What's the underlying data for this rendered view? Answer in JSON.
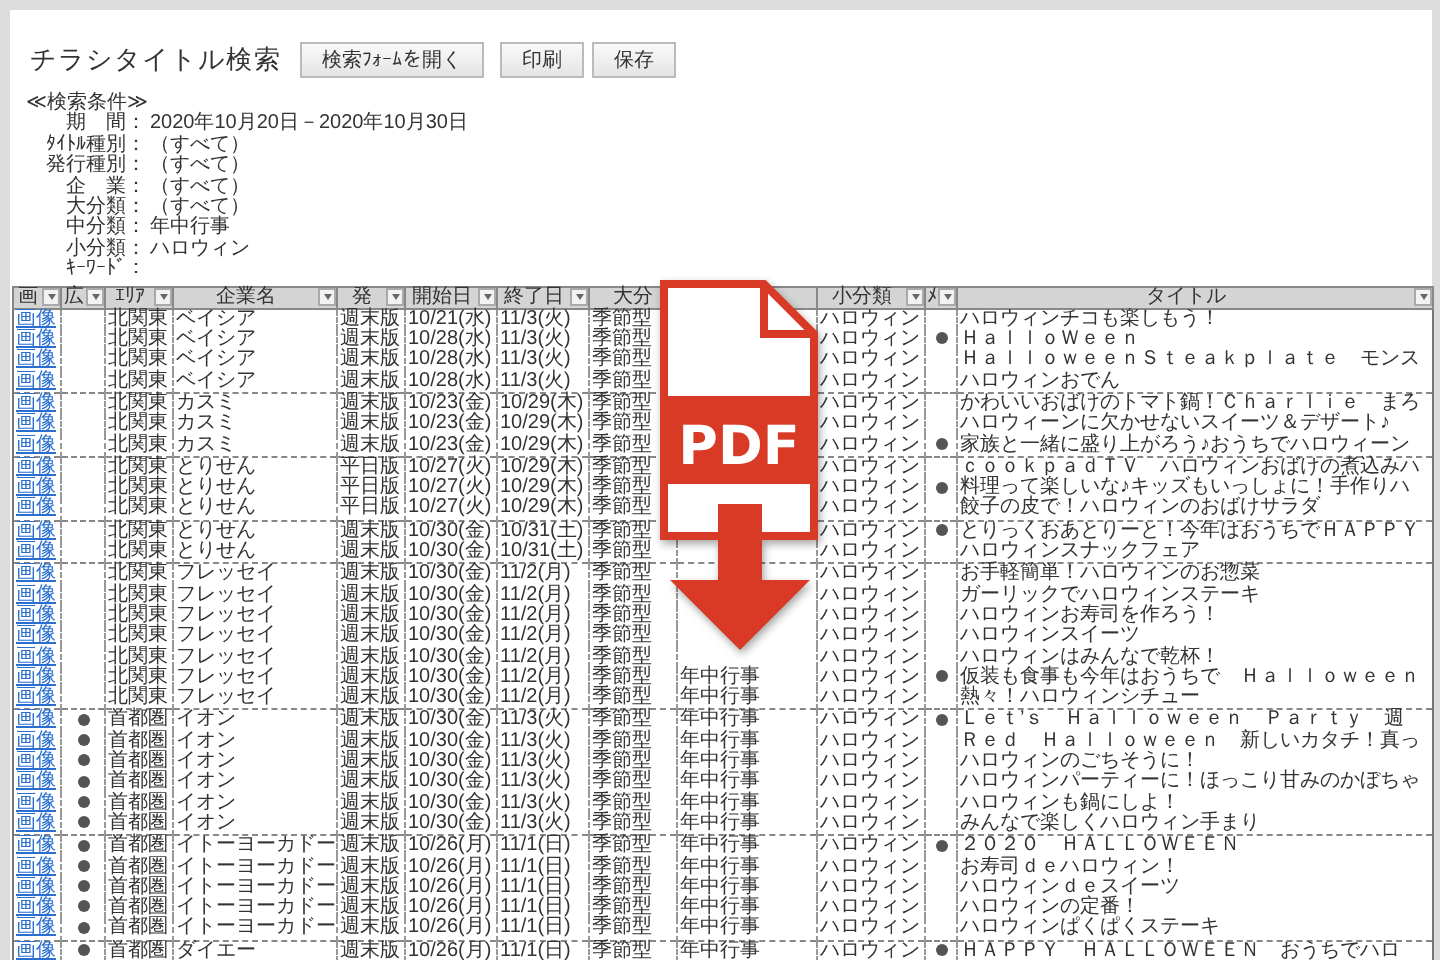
{
  "page_title": "チラシタイトル検索",
  "buttons": [
    "検索ﾌｫｰﾑを開く",
    "印刷",
    "保存"
  ],
  "conditions_heading": "≪検索条件≫",
  "conditions": [
    {
      "label": "期　間：",
      "value": "2020年10月20日－2020年10月30日"
    },
    {
      "label": "ﾀｲﾄﾙ種別：",
      "value": "（すべて）"
    },
    {
      "label": "発行種別：",
      "value": "（すべて）"
    },
    {
      "label": "企　業：",
      "value": "（すべて）"
    },
    {
      "label": "大分類：",
      "value": "（すべて）"
    },
    {
      "label": "中分類：",
      "value": "年中行事"
    },
    {
      "label": "小分類：",
      "value": "ハロウィン"
    },
    {
      "label": "ｷｰﾜｰﾄﾞ："
    }
  ],
  "overlay_badge": {
    "label": "PDF"
  },
  "table": {
    "columns": [
      {
        "label": "画",
        "filter": true
      },
      {
        "label": "広",
        "filter": true
      },
      {
        "label": "ｴﾘｱ",
        "filter": true
      },
      {
        "label": "企業名",
        "filter": true
      },
      {
        "label": "発",
        "filter": true
      },
      {
        "label": "開始日",
        "filter": true
      },
      {
        "label": "終了日",
        "filter": true
      },
      {
        "label": "大分",
        "filter": false
      },
      {
        "filter": false
      },
      {
        "label": "小分類",
        "filter": true
      },
      {
        "label": "ﾒ",
        "filter": true
      },
      {
        "label": "タイトル",
        "filter": true
      }
    ],
    "rows": [
      {
        "link": "画像",
        "ad": false,
        "area": "北関東",
        "company": "ベイシア",
        "edition": "週末版",
        "start": "10/21(水)",
        "end": "11/3(火)",
        "major": "季節型",
        "minor": "ハロウィン",
        "main": false,
        "title": "ハロウィンチコも楽しもう！",
        "group_start": true
      },
      {
        "link": "画像",
        "ad": false,
        "area": "北関東",
        "company": "ベイシア",
        "edition": "週末版",
        "start": "10/28(水)",
        "end": "11/3(火)",
        "major": "季節型",
        "minor": "ハロウィン",
        "main": true,
        "title": "ＨａｌｌｏＷｅｅｎ",
        "group_start": false
      },
      {
        "link": "画像",
        "ad": false,
        "area": "北関東",
        "company": "ベイシア",
        "edition": "週末版",
        "start": "10/28(水)",
        "end": "11/3(火)",
        "major": "季節型",
        "minor": "ハロウィン",
        "main": false,
        "title": "ＨａｌｌｏｗｅｅｎＳｔｅａｋｐｌａｔｅ　モンス",
        "group_start": false
      },
      {
        "link": "画像",
        "ad": false,
        "area": "北関東",
        "company": "ベイシア",
        "edition": "週末版",
        "start": "10/28(水)",
        "end": "11/3(火)",
        "major": "季節型",
        "minor": "ハロウィン",
        "main": false,
        "title": "ハロウィンおでん",
        "group_start": false
      },
      {
        "link": "画像",
        "ad": false,
        "area": "北関東",
        "company": "カスミ",
        "edition": "週末版",
        "start": "10/23(金)",
        "end": "10/29(木)",
        "major": "季節型",
        "minor": "ハロウィン",
        "main": false,
        "title": "かわいいおばけのトマト鍋！Ｃｈａｒｌｉｅ　まろ",
        "group_start": true
      },
      {
        "link": "画像",
        "ad": false,
        "area": "北関東",
        "company": "カスミ",
        "edition": "週末版",
        "start": "10/23(金)",
        "end": "10/29(木)",
        "major": "季節型",
        "minor": "ハロウィン",
        "main": false,
        "title": "ハロウィーンに欠かせないスイーツ＆デザート♪",
        "group_start": false
      },
      {
        "link": "画像",
        "ad": false,
        "area": "北関東",
        "company": "カスミ",
        "edition": "週末版",
        "start": "10/23(金)",
        "end": "10/29(木)",
        "major": "季節型",
        "minor": "ハロウィン",
        "main": true,
        "title": "家族と一緒に盛り上がろう♪おうちでハロウィーン",
        "group_start": false
      },
      {
        "link": "画像",
        "ad": false,
        "area": "北関東",
        "company": "とりせん",
        "edition": "平日版",
        "start": "10/27(火)",
        "end": "10/29(木)",
        "major": "季節型",
        "minor": "ハロウィン",
        "main": false,
        "title": "ｃｏｏｋｐａｄＴＶ　ハロウィンおばけの煮込みハ",
        "group_start": true
      },
      {
        "link": "画像",
        "ad": false,
        "area": "北関東",
        "company": "とりせん",
        "edition": "平日版",
        "start": "10/27(火)",
        "end": "10/29(木)",
        "major": "季節型",
        "minor": "ハロウィン",
        "main": true,
        "title": "料理って楽しいな♪キッズもいっしょに！手作りハ",
        "group_start": false
      },
      {
        "link": "画像",
        "ad": false,
        "area": "北関東",
        "company": "とりせん",
        "edition": "平日版",
        "start": "10/27(火)",
        "end": "10/29(木)",
        "major": "季節型",
        "minor": "ハロウィン",
        "main": false,
        "title": "餃子の皮で！ハロウィンのおばけサラダ",
        "group_start": false
      },
      {
        "link": "画像",
        "ad": false,
        "area": "北関東",
        "company": "とりせん",
        "edition": "週末版",
        "start": "10/30(金)",
        "end": "10/31(土)",
        "major": "季節型",
        "minor": "ハロウィン",
        "main": true,
        "title": "とりっくおあとりーと！今年はおうちでＨＡＰＰＹ",
        "group_start": true
      },
      {
        "link": "画像",
        "ad": false,
        "area": "北関東",
        "company": "とりせん",
        "edition": "週末版",
        "start": "10/30(金)",
        "end": "10/31(土)",
        "major": "季節型",
        "minor": "ハロウィン",
        "main": false,
        "title": "ハロウィンスナックフェア",
        "group_start": false
      },
      {
        "link": "画像",
        "ad": false,
        "area": "北関東",
        "company": "フレッセイ",
        "edition": "週末版",
        "start": "10/30(金)",
        "end": "11/2(月)",
        "major": "季節型",
        "minor": "ハロウィン",
        "main": false,
        "title": "お手軽簡単！ハロウィンのお惣菜",
        "group_start": true
      },
      {
        "link": "画像",
        "ad": false,
        "area": "北関東",
        "company": "フレッセイ",
        "edition": "週末版",
        "start": "10/30(金)",
        "end": "11/2(月)",
        "major": "季節型",
        "minor": "ハロウィン",
        "main": false,
        "title": "ガーリックでハロウィンステーキ",
        "group_start": false
      },
      {
        "link": "画像",
        "ad": false,
        "area": "北関東",
        "company": "フレッセイ",
        "edition": "週末版",
        "start": "10/30(金)",
        "end": "11/2(月)",
        "major": "季節型",
        "minor": "ハロウィン",
        "main": false,
        "title": "ハロウィンお寿司を作ろう！",
        "group_start": false
      },
      {
        "link": "画像",
        "ad": false,
        "area": "北関東",
        "company": "フレッセイ",
        "edition": "週末版",
        "start": "10/30(金)",
        "end": "11/2(月)",
        "major": "季節型",
        "minor": "ハロウィン",
        "main": false,
        "title": "ハロウィンスイーツ",
        "group_start": false
      },
      {
        "link": "画像",
        "ad": false,
        "area": "北関東",
        "company": "フレッセイ",
        "edition": "週末版",
        "start": "10/30(金)",
        "end": "11/2(月)",
        "major": "季節型",
        "minor": "ハロウィン",
        "main": false,
        "title": "ハロウィンはみんなで乾杯！",
        "group_start": false
      },
      {
        "link": "画像",
        "ad": false,
        "area": "北関東",
        "company": "フレッセイ",
        "edition": "週末版",
        "start": "10/30(金)",
        "end": "11/2(月)",
        "major": "季節型",
        "mid": "年中行事",
        "minor": "ハロウィン",
        "main": true,
        "title": "仮装も食事も今年はおうちで　Ｈａｌｌｏｗｅｅｎ",
        "group_start": false
      },
      {
        "link": "画像",
        "ad": false,
        "area": "北関東",
        "company": "フレッセイ",
        "edition": "週末版",
        "start": "10/30(金)",
        "end": "11/2(月)",
        "major": "季節型",
        "mid": "年中行事",
        "minor": "ハロウィン",
        "main": false,
        "title": "熱々！ハロウィンシチュー",
        "group_start": false
      },
      {
        "link": "画像",
        "ad": true,
        "area": "首都圏",
        "company": "イオン",
        "edition": "週末版",
        "start": "10/30(金)",
        "end": "11/3(火)",
        "major": "季節型",
        "mid": "年中行事",
        "minor": "ハロウィン",
        "main": true,
        "title": "Ｌｅｔ’ｓ　Ｈａｌｌｏｗｅｅｎ　Ｐａｒｔｙ　週",
        "group_start": true
      },
      {
        "link": "画像",
        "ad": true,
        "area": "首都圏",
        "company": "イオン",
        "edition": "週末版",
        "start": "10/30(金)",
        "end": "11/3(火)",
        "major": "季節型",
        "mid": "年中行事",
        "minor": "ハロウィン",
        "main": false,
        "title": "Ｒｅｄ　Ｈａｌｌｏｗｅｅｎ　新しいカタチ！真っ",
        "group_start": false
      },
      {
        "link": "画像",
        "ad": true,
        "area": "首都圏",
        "company": "イオン",
        "edition": "週末版",
        "start": "10/30(金)",
        "end": "11/3(火)",
        "major": "季節型",
        "mid": "年中行事",
        "minor": "ハロウィン",
        "main": false,
        "title": "ハロウィンのごちそうに！",
        "group_start": false
      },
      {
        "link": "画像",
        "ad": true,
        "area": "首都圏",
        "company": "イオン",
        "edition": "週末版",
        "start": "10/30(金)",
        "end": "11/3(火)",
        "major": "季節型",
        "mid": "年中行事",
        "minor": "ハロウィン",
        "main": false,
        "title": "ハロウィンパーティーに！ほっこり甘みのかぼちゃ",
        "group_start": false
      },
      {
        "link": "画像",
        "ad": true,
        "area": "首都圏",
        "company": "イオン",
        "edition": "週末版",
        "start": "10/30(金)",
        "end": "11/3(火)",
        "major": "季節型",
        "mid": "年中行事",
        "minor": "ハロウィン",
        "main": false,
        "title": "ハロウィンも鍋にしよ！",
        "group_start": false
      },
      {
        "link": "画像",
        "ad": true,
        "area": "首都圏",
        "company": "イオン",
        "edition": "週末版",
        "start": "10/30(金)",
        "end": "11/3(火)",
        "major": "季節型",
        "mid": "年中行事",
        "minor": "ハロウィン",
        "main": false,
        "title": "みんなで楽しくハロウィン手まり",
        "group_start": false
      },
      {
        "link": "画像",
        "ad": true,
        "area": "首都圏",
        "company": "イトーヨーカドー",
        "edition": "週末版",
        "start": "10/26(月)",
        "end": "11/1(日)",
        "major": "季節型",
        "mid": "年中行事",
        "minor": "ハロウィン",
        "main": true,
        "title": "２０２０　ＨＡＬＬＯＷＥＥＮ",
        "group_start": true
      },
      {
        "link": "画像",
        "ad": true,
        "area": "首都圏",
        "company": "イトーヨーカドー",
        "edition": "週末版",
        "start": "10/26(月)",
        "end": "11/1(日)",
        "major": "季節型",
        "mid": "年中行事",
        "minor": "ハロウィン",
        "main": false,
        "title": "お寿司ｄｅハロウィン！",
        "group_start": false
      },
      {
        "link": "画像",
        "ad": true,
        "area": "首都圏",
        "company": "イトーヨーカドー",
        "edition": "週末版",
        "start": "10/26(月)",
        "end": "11/1(日)",
        "major": "季節型",
        "mid": "年中行事",
        "minor": "ハロウィン",
        "main": false,
        "title": "ハロウィンｄｅスイーツ",
        "group_start": false
      },
      {
        "link": "画像",
        "ad": true,
        "area": "首都圏",
        "company": "イトーヨーカドー",
        "edition": "週末版",
        "start": "10/26(月)",
        "end": "11/1(日)",
        "major": "季節型",
        "mid": "年中行事",
        "minor": "ハロウィン",
        "main": false,
        "title": "ハロウィンの定番！",
        "group_start": false
      },
      {
        "link": "画像",
        "ad": true,
        "area": "首都圏",
        "company": "イトーヨーカドー",
        "edition": "週末版",
        "start": "10/26(月)",
        "end": "11/1(日)",
        "major": "季節型",
        "mid": "年中行事",
        "minor": "ハロウィン",
        "main": false,
        "title": "ハロウィンぱくぱくステーキ",
        "group_start": false
      },
      {
        "link": "画像",
        "ad": true,
        "area": "首都圏",
        "company": "ダイエー",
        "edition": "週末版",
        "start": "10/26(月)",
        "end": "11/1(日)",
        "major": "季節型",
        "mid": "年中行事",
        "minor": "ハロウィン",
        "main": true,
        "title": "ＨＡＰＰＹ　ＨＡＬＬＯＷＥＥＮ　おうちでハロ",
        "group_start": true
      }
    ]
  }
}
